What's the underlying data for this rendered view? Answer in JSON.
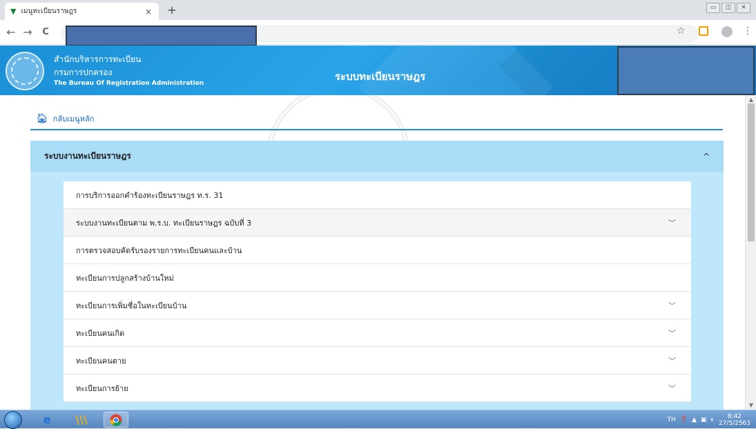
{
  "browser": {
    "tab_title": "เมนูทะเบียนราษฎร",
    "tab_close": "×",
    "new_tab": "+",
    "window_controls": [
      "▭",
      "◫",
      "✕"
    ],
    "back": "←",
    "forward": "→",
    "reload": "C",
    "star": "☆",
    "menu": "⋮"
  },
  "header": {
    "org_line1": "สำนักบริหารการทะเบียน",
    "org_line2": "กรมการปกครอง",
    "org_line3": "The Bureau Of Registration Administration",
    "system_title": "ระบบทะเบียนราษฎร"
  },
  "nav": {
    "back_label": "กลับเมนูหลัก"
  },
  "panel": {
    "title": "ระบบงานทะเบียนราษฎร",
    "collapse_icon": "^",
    "items": [
      {
        "label": "การบริการออกคำร้องทะเบียนราษฎร ท.ร. 31",
        "chevron": ""
      },
      {
        "label": "ระบบงานทะเบียนตาม พ.ร.บ. ทะเบียนราษฎร ฉบับที่ 3",
        "chevron": "﹀"
      },
      {
        "label": "การตรวจสอบคัดรับรองรายการทะเบียนคนและบ้าน",
        "chevron": ""
      },
      {
        "label": "ทะเบียนการปลูกสร้างบ้านใหม่",
        "chevron": ""
      },
      {
        "label": "ทะเบียนการเพิ่มชื่อในทะเบียนบ้าน",
        "chevron": "﹀"
      },
      {
        "label": "ทะเบียนคนเกิด",
        "chevron": "﹀"
      },
      {
        "label": "ทะเบียนคนตาย",
        "chevron": "﹀"
      },
      {
        "label": "ทะเบียนการย้าย",
        "chevron": "﹀"
      }
    ]
  },
  "taskbar": {
    "lang": "TH",
    "time": "8:42",
    "date": "27/5/2563"
  },
  "colors": {
    "header_blue": "#1a8fd6",
    "panel_bg": "#bfe7fb",
    "link_blue": "#1565c0"
  }
}
